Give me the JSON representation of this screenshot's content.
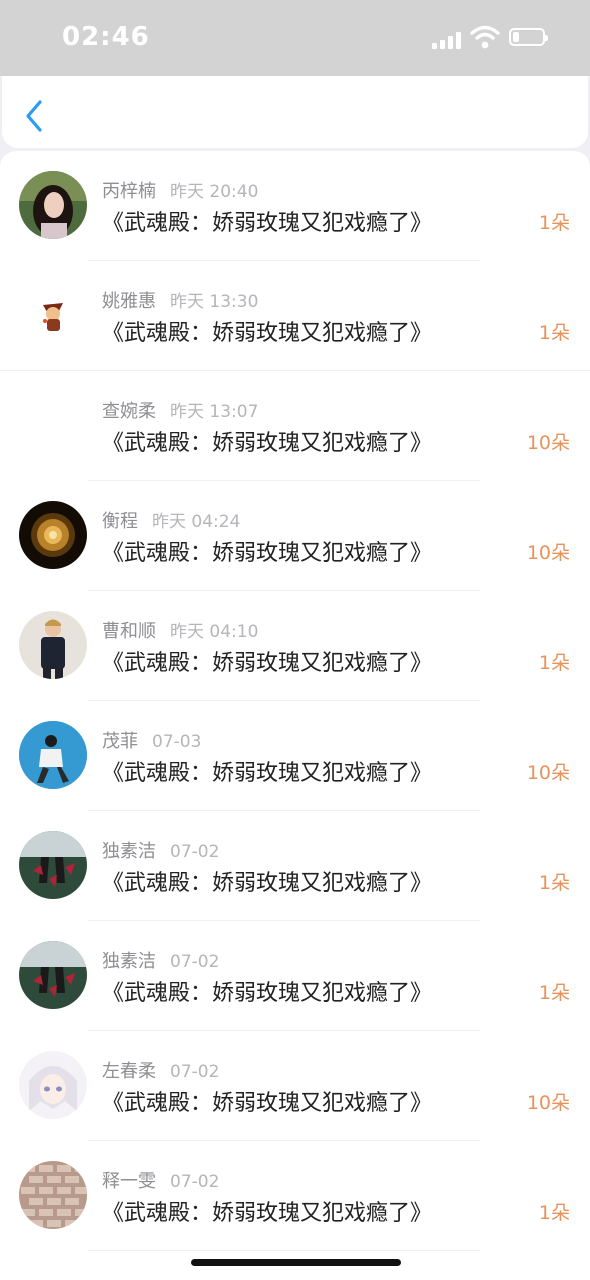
{
  "status_bar": {
    "time": "02:46"
  },
  "list": [
    {
      "name": "丙梓楠",
      "time": "昨天 20:40",
      "title": "《武魂殿：娇弱玫瑰又犯戏瘾了》",
      "count": "1朵",
      "avatar": "girl-photo"
    },
    {
      "name": "姚雅惠",
      "time": "昨天 13:30",
      "title": "《武魂殿：娇弱玫瑰又犯戏瘾了》",
      "count": "1朵",
      "avatar": "cartoon-character"
    },
    {
      "name": "查婉柔",
      "time": "昨天 13:07",
      "title": "《武魂殿：娇弱玫瑰又犯戏瘾了》",
      "count": "10朵",
      "avatar": "blank"
    },
    {
      "name": "衡程",
      "time": "昨天 04:24",
      "title": "《武魂殿：娇弱玫瑰又犯戏瘾了》",
      "count": "10朵",
      "avatar": "dandelion"
    },
    {
      "name": "曹和顺",
      "time": "昨天 04:10",
      "title": "《武魂殿：娇弱玫瑰又犯戏瘾了》",
      "count": "1朵",
      "avatar": "man-standing"
    },
    {
      "name": "茂菲",
      "time": "07-03",
      "title": "《武魂殿：娇弱玫瑰又犯戏瘾了》",
      "count": "10朵",
      "avatar": "person-blue-wall"
    },
    {
      "name": "独素洁",
      "time": "07-02",
      "title": "《武魂殿：娇弱玫瑰又犯戏瘾了》",
      "count": "1朵",
      "avatar": "butterflies"
    },
    {
      "name": "独素洁",
      "time": "07-02",
      "title": "《武魂殿：娇弱玫瑰又犯戏瘾了》",
      "count": "1朵",
      "avatar": "butterflies"
    },
    {
      "name": "左春柔",
      "time": "07-02",
      "title": "《武魂殿：娇弱玫瑰又犯戏瘾了》",
      "count": "10朵",
      "avatar": "anime-girl"
    },
    {
      "name": "释一雯",
      "time": "07-02",
      "title": "《武魂殿：娇弱玫瑰又犯戏瘾了》",
      "count": "1朵",
      "avatar": "brick-wall"
    }
  ],
  "colors": {
    "accent": "#2b9bf4",
    "count": "#e8935b",
    "name": "#8e8e93",
    "title": "#222222"
  }
}
